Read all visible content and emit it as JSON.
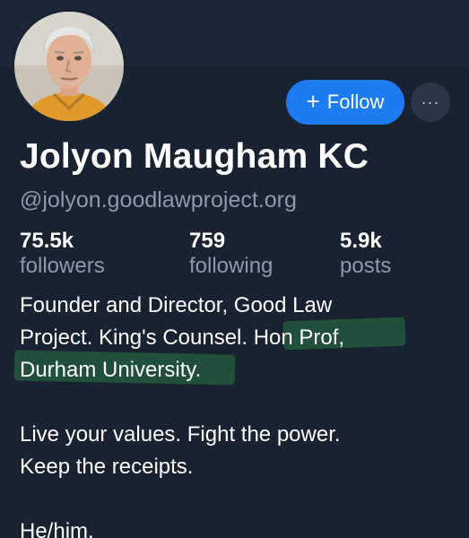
{
  "profile": {
    "display_name": "Jolyon Maugham KC",
    "handle": "@jolyon.goodlawproject.org",
    "follow_label": "Follow",
    "more_label": "···",
    "avatar_icon": "avatar-photo",
    "stats": {
      "followers_value": "75.5k",
      "followers_label": "followers",
      "following_value": "759",
      "following_label": "following",
      "posts_value": "5.9k",
      "posts_label": "posts"
    },
    "bio": {
      "line1": "Founder and Director, Good Law",
      "line2": "Project. King's Counsel. Hon Prof,",
      "line3": "Durham University.",
      "line4": "Live your values. Fight the power.",
      "line5": "Keep the receipts.",
      "line6": "He/him."
    },
    "colors": {
      "background": "#182231",
      "accent": "#1e7cf2",
      "muted_text": "#8d9aab",
      "highlight": "#2e9646"
    }
  }
}
